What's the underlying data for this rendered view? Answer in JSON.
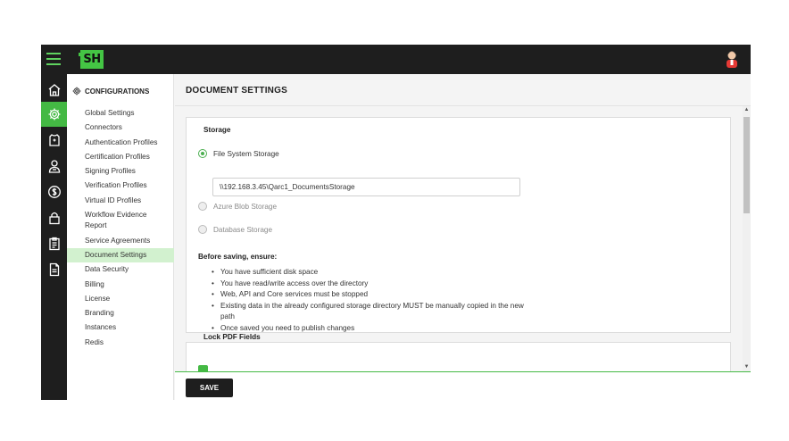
{
  "topbar": {
    "logo_text": "SH",
    "menu_icon": "hamburger-icon",
    "user_icon": "user-avatar-icon"
  },
  "rail": {
    "items": [
      {
        "icon": "home-icon",
        "active": false
      },
      {
        "icon": "gear-icon",
        "active": true
      },
      {
        "icon": "shirt-document-icon",
        "active": false
      },
      {
        "icon": "user-badge-icon",
        "active": false
      },
      {
        "icon": "dollar-icon",
        "active": false
      },
      {
        "icon": "lock-icon",
        "active": false
      },
      {
        "icon": "clipboard-icon",
        "active": false
      },
      {
        "icon": "document-icon",
        "active": false
      }
    ]
  },
  "sidenav": {
    "heading": "CONFIGURATIONS",
    "items": [
      {
        "label": "Global Settings",
        "active": false
      },
      {
        "label": "Connectors",
        "active": false
      },
      {
        "label": "Authentication Profiles",
        "active": false
      },
      {
        "label": "Certification Profiles",
        "active": false
      },
      {
        "label": "Signing Profiles",
        "active": false
      },
      {
        "label": "Verification Profiles",
        "active": false
      },
      {
        "label": "Virtual ID Profiles",
        "active": false
      },
      {
        "label": "Workflow Evidence Report",
        "active": false
      },
      {
        "label": "Service Agreements",
        "active": false
      },
      {
        "label": "Document Settings",
        "active": true
      },
      {
        "label": "Data Security",
        "active": false
      },
      {
        "label": "Billing",
        "active": false
      },
      {
        "label": "License",
        "active": false
      },
      {
        "label": "Branding",
        "active": false
      },
      {
        "label": "Instances",
        "active": false
      },
      {
        "label": "Redis",
        "active": false
      }
    ]
  },
  "main": {
    "title": "DOCUMENT SETTINGS",
    "storage": {
      "title": "Storage",
      "options": [
        {
          "label": "File System Storage",
          "checked": true,
          "disabled": false
        },
        {
          "label": "Azure Blob Storage",
          "checked": false,
          "disabled": true
        },
        {
          "label": "Database Storage",
          "checked": false,
          "disabled": true
        }
      ],
      "path_value": "\\\\192.168.3.45\\Qarc1_DocumentsStorage",
      "notes_title": "Before saving, ensure:",
      "notes": [
        "You have sufficient disk space",
        "You have read/write access over the directory",
        "Web, API and Core services must be stopped",
        "Existing data in the already configured storage directory MUST be manually copied in the new path",
        "Once saved you need to publish changes"
      ]
    },
    "lock_pdf": {
      "title": "Lock PDF Fields",
      "checked": true
    },
    "save_label": "SAVE"
  },
  "colors": {
    "accent": "#44b944",
    "dark": "#1e1e1e",
    "active_nav": "#d2f1cf"
  }
}
